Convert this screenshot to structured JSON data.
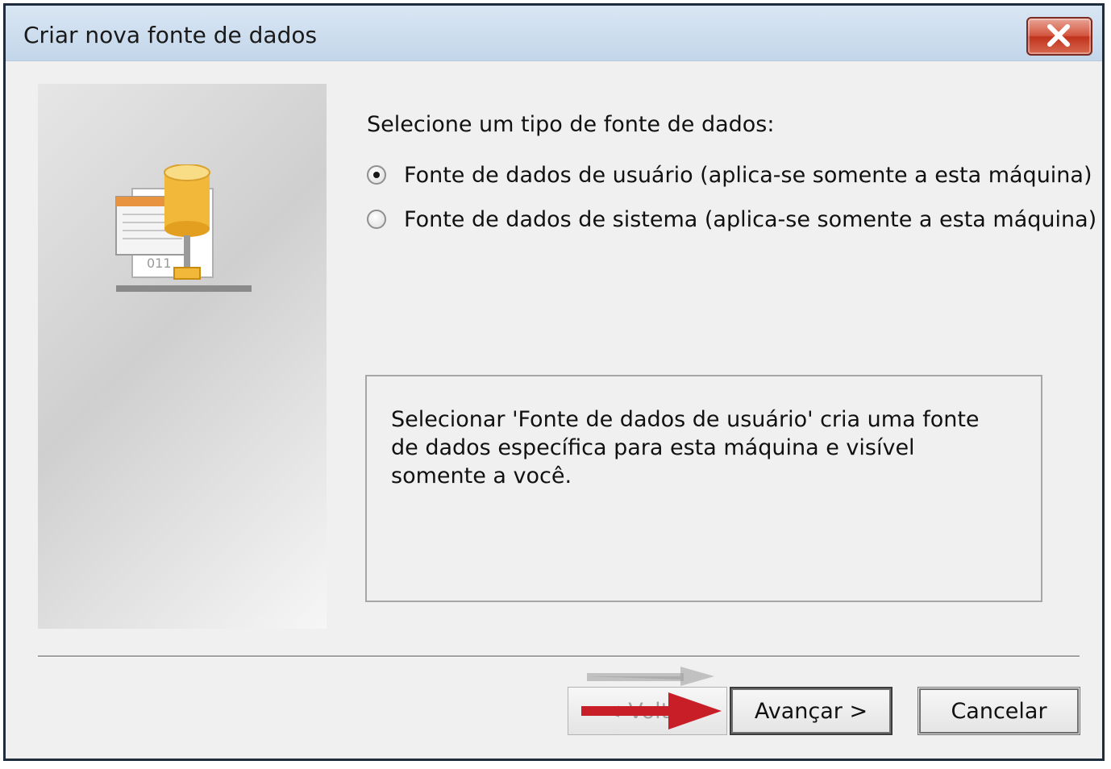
{
  "window": {
    "title": "Criar nova fonte de dados"
  },
  "icons": {
    "close": "close-icon",
    "data_source": "data-source-icon"
  },
  "content": {
    "prompt": "Selecione um tipo de fonte de dados:",
    "options": [
      {
        "label": "Fonte de dados de usuário (aplica-se somente a esta máquina)",
        "selected": true
      },
      {
        "label": "Fonte de dados de sistema (aplica-se somente a esta máquina)",
        "selected": false
      }
    ],
    "description": "Selecionar 'Fonte de dados de usuário' cria uma fonte de dados específica para esta máquina e visível somente a você."
  },
  "buttons": {
    "back": "< Voltar",
    "next": "Avançar >",
    "cancel": "Cancelar"
  },
  "colors": {
    "title_bar": "#c3d6ea",
    "close_button": "#d4563f",
    "annotation_arrow": "#c81e28",
    "dialog_background": "#f0f0f0"
  }
}
